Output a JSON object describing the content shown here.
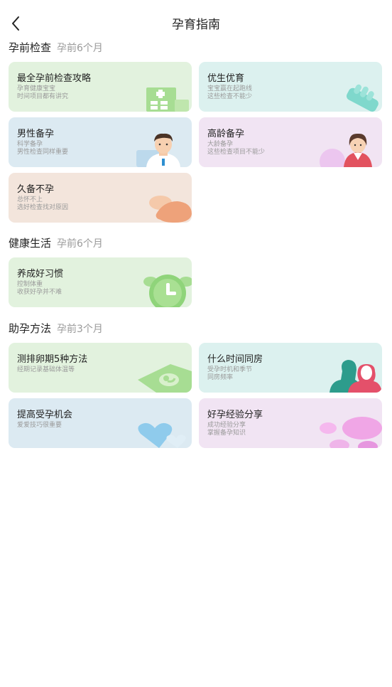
{
  "header": {
    "title": "孕育指南"
  },
  "sections": [
    {
      "title": "孕前检查",
      "sub": "孕前6个月"
    },
    {
      "title": "健康生活",
      "sub": "孕前6个月"
    },
    {
      "title": "助孕方法",
      "sub": "孕前3个月"
    }
  ],
  "cards": [
    {
      "title": "最全孕前检查攻略",
      "lines": [
        "孕育健康宝宝",
        "时间项目都有讲究"
      ],
      "icon": "hospital-icon"
    },
    {
      "title": "优生优育",
      "lines": [
        "宝宝赢在起跑线",
        "这些检查不能少"
      ],
      "icon": "gloved-hand-icon"
    },
    {
      "title": "男性备孕",
      "lines": [
        "科学备孕",
        "男性检查同样重要"
      ],
      "icon": "male-doctor-icon"
    },
    {
      "title": "高龄备孕",
      "lines": [
        "大龄备孕",
        "这些检查项目不能少"
      ],
      "icon": "woman-icon"
    },
    {
      "title": "久备不孕",
      "lines": [
        "总怀不上",
        "选好检查找对原因"
      ],
      "icon": "hands-icon"
    },
    {
      "title": "养成好习惯",
      "lines": [
        "控制体重",
        "收获好孕并不难"
      ],
      "icon": "alarm-clock-icon"
    },
    {
      "title": "测排卵期5种方法",
      "lines": [
        "经期记录基础体温等"
      ],
      "icon": "ultrasound-icon"
    },
    {
      "title": "什么时间同房",
      "lines": [
        "受孕时机和季节",
        "同房频率"
      ],
      "icon": "couple-icon"
    },
    {
      "title": "提高受孕机会",
      "lines": [
        "爱爱技巧很重要"
      ],
      "icon": "hearts-icon"
    },
    {
      "title": "好孕经验分享",
      "lines": [
        "成功经验分享",
        "掌握备孕知识"
      ],
      "icon": "chat-bubbles-icon"
    }
  ]
}
